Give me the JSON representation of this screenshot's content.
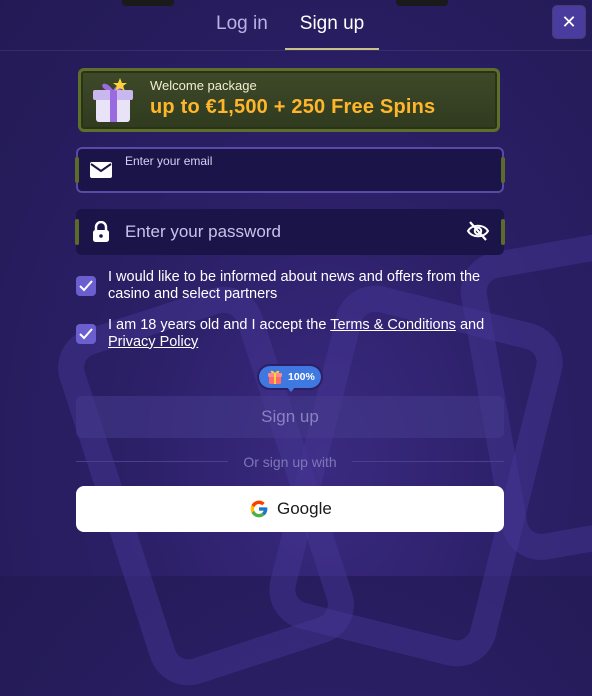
{
  "tabs": {
    "login": "Log in",
    "signup": "Sign up"
  },
  "close_label": "✕",
  "promo": {
    "title": "Welcome package",
    "amount": "up to €1,500 + 250 Free Spins"
  },
  "email": {
    "label": "Enter your email",
    "value": ""
  },
  "password": {
    "placeholder": "Enter your password"
  },
  "consents": [
    {
      "checked": true,
      "text": "I would like to be informed about news and offers from the casino and select partners"
    },
    {
      "checked": true,
      "prefix": "I am 18 years old and I accept the ",
      "terms_link": "Terms & Conditions",
      "middle": " and ",
      "privacy_link": "Privacy Policy"
    }
  ],
  "badge": {
    "text": "100%"
  },
  "signup_button": "Sign up",
  "divider_text": "Or sign up with",
  "google_button": "Google",
  "colors": {
    "background": "#2b1f66",
    "accent": "#6b5fd0",
    "promo_gold": "#ffb62b",
    "badge_blue": "#3f78e0"
  }
}
